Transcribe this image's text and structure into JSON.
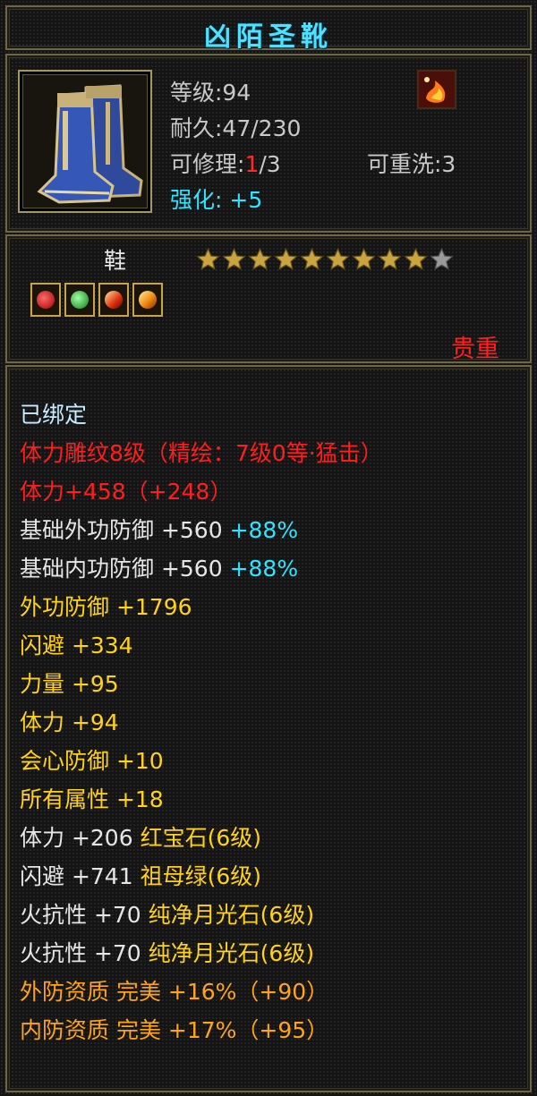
{
  "title": "凶陌圣靴",
  "item": {
    "level_label": "等级:94",
    "durability_label": "耐久:47/230",
    "repair_prefix": "可修理:",
    "repair_used": "1",
    "repair_total": "/3",
    "rewash_label": "可重洗:3",
    "enhance_label": "强化:",
    "enhance_value": "+5",
    "bound_icon": "flame-emblem-icon",
    "image_icon": "blue-gold-boots-icon"
  },
  "details": {
    "slot": "鞋",
    "stars_filled": 9,
    "stars_total": 10,
    "gem_icons": [
      "red-gem-icon",
      "green-gem-icon",
      "fire-wing-gem-icon",
      "gold-wing-gem-icon"
    ],
    "quality": "贵重"
  },
  "attributes": [
    {
      "parts": [
        {
          "text": "已绑定",
          "color": "bind"
        }
      ]
    },
    {
      "parts": [
        {
          "text": "体力雕纹8级（精绘：7级0等·猛击）",
          "color": "red"
        }
      ]
    },
    {
      "parts": [
        {
          "text": "体力+458（+248）",
          "color": "red"
        }
      ]
    },
    {
      "parts": [
        {
          "text": "基础外功防御 +560 ",
          "color": "white"
        },
        {
          "text": "+88%",
          "color": "cyan"
        }
      ]
    },
    {
      "parts": [
        {
          "text": "基础内功防御 +560 ",
          "color": "white"
        },
        {
          "text": "+88%",
          "color": "cyan"
        }
      ]
    },
    {
      "parts": [
        {
          "text": "外功防御 +1796",
          "color": "yellow"
        }
      ]
    },
    {
      "parts": [
        {
          "text": "闪避 +334",
          "color": "yellow"
        }
      ]
    },
    {
      "parts": [
        {
          "text": "力量 +95",
          "color": "yellow"
        }
      ]
    },
    {
      "parts": [
        {
          "text": "体力 +94",
          "color": "yellow"
        }
      ]
    },
    {
      "parts": [
        {
          "text": "会心防御 +10",
          "color": "yellow"
        }
      ]
    },
    {
      "parts": [
        {
          "text": "所有属性 +18",
          "color": "yellow"
        }
      ]
    },
    {
      "parts": [
        {
          "text": "体力 +206 ",
          "color": "white"
        },
        {
          "text": "红宝石(6级)",
          "color": "yellow"
        }
      ]
    },
    {
      "parts": [
        {
          "text": "闪避 +741 ",
          "color": "white"
        },
        {
          "text": "祖母绿(6级)",
          "color": "yellow"
        }
      ]
    },
    {
      "parts": [
        {
          "text": "火抗性 +70 ",
          "color": "white"
        },
        {
          "text": "纯净月光石(6级)",
          "color": "yellow"
        }
      ]
    },
    {
      "parts": [
        {
          "text": "火抗性 +70 ",
          "color": "white"
        },
        {
          "text": "纯净月光石(6级)",
          "color": "yellow"
        }
      ]
    },
    {
      "parts": [
        {
          "text": "外防资质 完美 +16%（+90）",
          "color": "orange"
        }
      ]
    },
    {
      "parts": [
        {
          "text": "内防资质 完美 +17%（+95）",
          "color": "orange"
        }
      ]
    }
  ],
  "colors": {
    "title": "#4fe0ff",
    "bind": "#c8ecff",
    "red": "#ff1e1e",
    "white": "#e6e6e6",
    "yellow": "#ffd21a",
    "orange": "#ffa41a",
    "cyan": "#2ee4ff",
    "border": "#6e6649"
  }
}
